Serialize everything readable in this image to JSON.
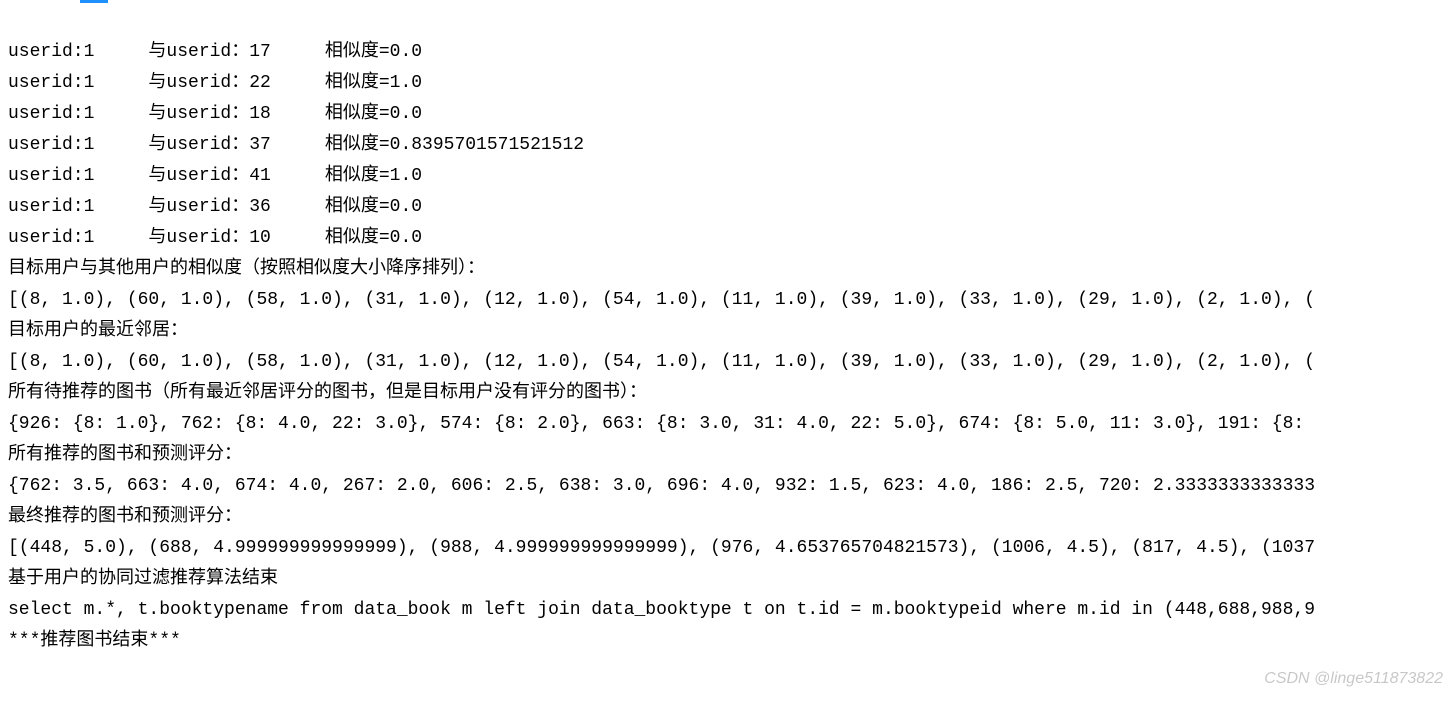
{
  "lines": [
    "userid:1     与userid：17     相似度=0.0",
    "userid:1     与userid：22     相似度=1.0",
    "userid:1     与userid：18     相似度=0.0",
    "userid:1     与userid：37     相似度=0.8395701571521512",
    "userid:1     与userid：41     相似度=1.0",
    "userid:1     与userid：36     相似度=0.0",
    "userid:1     与userid：10     相似度=0.0",
    "目标用户与其他用户的相似度（按照相似度大小降序排列）：",
    "[(8, 1.0), (60, 1.0), (58, 1.0), (31, 1.0), (12, 1.0), (54, 1.0), (11, 1.0), (39, 1.0), (33, 1.0), (29, 1.0), (2, 1.0), (",
    "目标用户的最近邻居：",
    "[(8, 1.0), (60, 1.0), (58, 1.0), (31, 1.0), (12, 1.0), (54, 1.0), (11, 1.0), (39, 1.0), (33, 1.0), (29, 1.0), (2, 1.0), (",
    "所有待推荐的图书（所有最近邻居评分的图书，但是目标用户没有评分的图书）：",
    "{926: {8: 1.0}, 762: {8: 4.0, 22: 3.0}, 574: {8: 2.0}, 663: {8: 3.0, 31: 4.0, 22: 5.0}, 674: {8: 5.0, 11: 3.0}, 191: {8:",
    "所有推荐的图书和预测评分：",
    "{762: 3.5, 663: 4.0, 674: 4.0, 267: 2.0, 606: 2.5, 638: 3.0, 696: 4.0, 932: 1.5, 623: 4.0, 186: 2.5, 720: 2.3333333333333",
    "最终推荐的图书和预测评分：",
    "[(448, 5.0), (688, 4.999999999999999), (988, 4.999999999999999), (976, 4.653765704821573), (1006, 4.5), (817, 4.5), (1037",
    "基于用户的协同过滤推荐算法结束",
    "select m.*, t.booktypename from data_book m left join data_booktype t on t.id = m.booktypeid where m.id in (448,688,988,9",
    "***推荐图书结束***"
  ],
  "watermark": "CSDN @linge511873822"
}
